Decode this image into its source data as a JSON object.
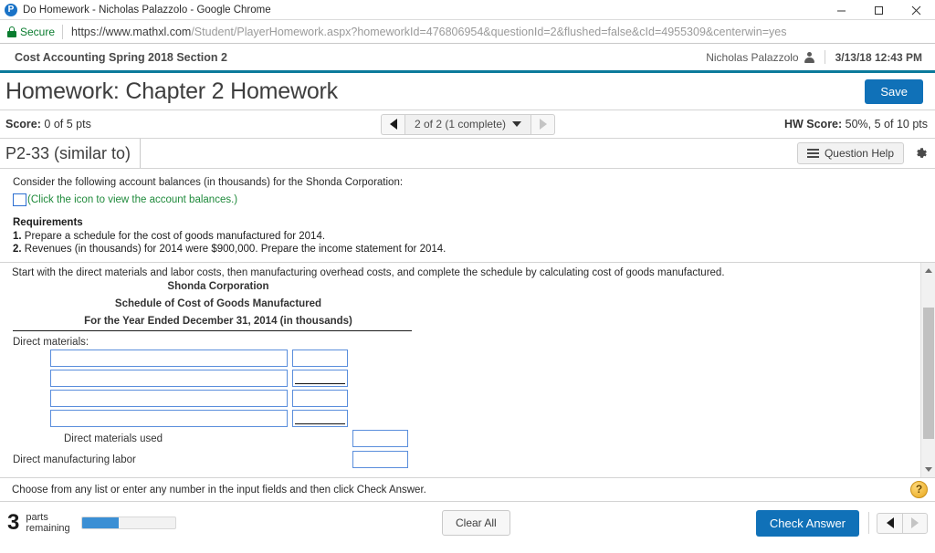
{
  "browser": {
    "window_title": "Do Homework - Nicholas Palazzolo - Google Chrome",
    "favicon_letter": "P",
    "security_label": "Secure",
    "url_domain": "https://www.mathxl.com",
    "url_path": "/Student/PlayerHomework.aspx?homeworkId=476806954&questionId=2&flushed=false&cId=4955309&centerwin=yes",
    "minimize_label": "Minimize",
    "maximize_label": "Maximize",
    "close_label": "Close"
  },
  "course_bar": {
    "course_title": "Cost Accounting Spring 2018 Section 2",
    "user_name": "Nicholas Palazzolo",
    "timestamp": "3/13/18 12:43 PM"
  },
  "header": {
    "title": "Homework: Chapter 2 Homework",
    "save_label": "Save"
  },
  "score_row": {
    "score_label": "Score:",
    "score_value": "0 of 5 pts",
    "nav_value": "2 of 2 (1 complete)",
    "hw_score_label": "HW Score:",
    "hw_score_value": "50%, 5 of 10 pts"
  },
  "problem_row": {
    "problem_id": "P2-33 (similar to)",
    "question_help_label": "Question Help",
    "settings_label": "Settings"
  },
  "question": {
    "intro": "Consider the following account balances (in thousands) for the Shonda Corporation:",
    "icon_link": "(Click the icon to view the account balances.)",
    "requirements_title": "Requirements",
    "req_1_num": "1.",
    "req_1_text": "Prepare a schedule for the cost of goods manufactured for 2014.",
    "req_2_num": "2.",
    "req_2_text": "Revenues (in thousands) for 2014 were $900,000. Prepare the income statement for 2014."
  },
  "work_area": {
    "instruction": "Start with the direct materials and labor costs, then manufacturing overhead costs, and complete the schedule by calculating cost of goods manufactured.",
    "schedule_heading_1": "Shonda Corporation",
    "schedule_heading_2": "Schedule of Cost of Goods Manufactured",
    "schedule_heading_3": "For the Year Ended December 31, 2014 (in thousands)",
    "section_label": "Direct materials:",
    "input_rows": [
      {
        "text_value": "",
        "num_value": "",
        "underlined": false
      },
      {
        "text_value": "",
        "num_value": "",
        "underlined": true
      },
      {
        "text_value": "",
        "num_value": "",
        "underlined": false
      },
      {
        "text_value": "",
        "num_value": "",
        "underlined": true
      }
    ],
    "subtotal_label": "Direct materials used",
    "subtotal_value": "",
    "next_label": "Direct manufacturing labor",
    "next_value": ""
  },
  "hint_row": {
    "text": "Choose from any list or enter any number in the input fields and then click Check Answer.",
    "help_glyph": "?"
  },
  "footer": {
    "parts_count": "3",
    "parts_line_1": "parts",
    "parts_line_2": "remaining",
    "progress_percent": 40,
    "clear_label": "Clear All",
    "check_label": "Check Answer"
  },
  "colors": {
    "accent_blue": "#1071b8",
    "teal_rule": "#0b7a9b",
    "green_link": "#1f8a3b",
    "input_border": "#5a8edc"
  }
}
